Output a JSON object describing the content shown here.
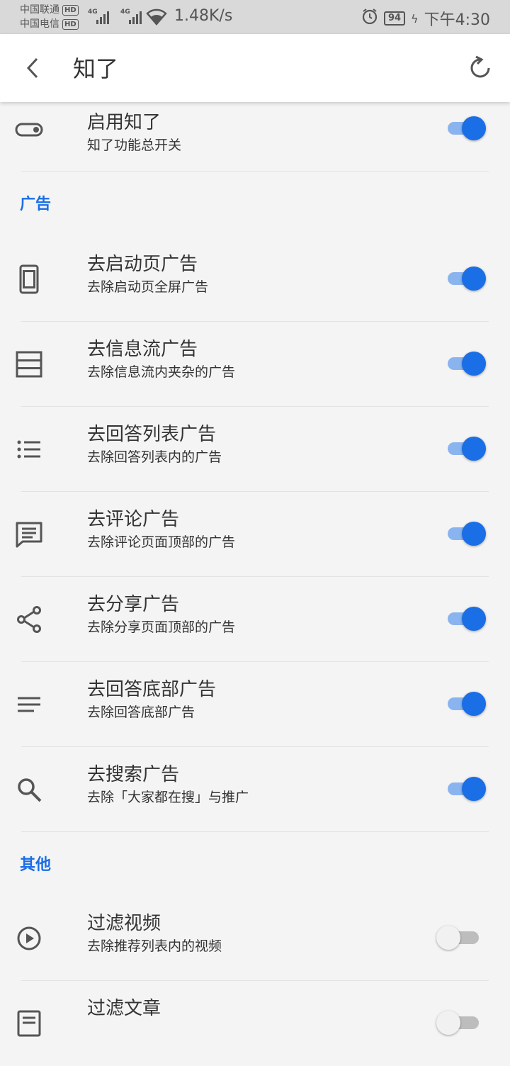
{
  "status_bar": {
    "carrier1": "中国联通",
    "carrier2": "中国电信",
    "hd": "HD",
    "network": "4G",
    "speed": "1.48K/s",
    "battery": "94",
    "time": "下午4:30"
  },
  "toolbar": {
    "title": "知了",
    "back_icon": "chevron-left-icon",
    "refresh_icon": "refresh-icon"
  },
  "master": {
    "title": "启用知了",
    "subtitle": "知了功能总开关",
    "icon": "toggle-icon",
    "enabled": true
  },
  "sections": {
    "ads_label": "广告",
    "other_label": "其他"
  },
  "ad_items": [
    {
      "title": "去启动页广告",
      "subtitle": "去除启动页全屏广告",
      "icon": "phone-icon",
      "enabled": true
    },
    {
      "title": "去信息流广告",
      "subtitle": "去除信息流内夹杂的广告",
      "icon": "feed-icon",
      "enabled": true
    },
    {
      "title": "去回答列表广告",
      "subtitle": "去除回答列表内的广告",
      "icon": "list-icon",
      "enabled": true
    },
    {
      "title": "去评论广告",
      "subtitle": "去除评论页面顶部的广告",
      "icon": "comment-icon",
      "enabled": true
    },
    {
      "title": "去分享广告",
      "subtitle": "去除分享页面顶部的广告",
      "icon": "share-icon",
      "enabled": true
    },
    {
      "title": "去回答底部广告",
      "subtitle": "去除回答底部广告",
      "icon": "notes-icon",
      "enabled": true
    },
    {
      "title": "去搜索广告",
      "subtitle": "去除「大家都在搜」与推广",
      "icon": "search-icon",
      "enabled": true
    }
  ],
  "other_items": [
    {
      "title": "过滤视频",
      "subtitle": "去除推荐列表内的视频",
      "icon": "play-circle-icon",
      "enabled": false
    },
    {
      "title": "过滤文章",
      "subtitle": "",
      "icon": "article-icon",
      "enabled": false
    }
  ]
}
